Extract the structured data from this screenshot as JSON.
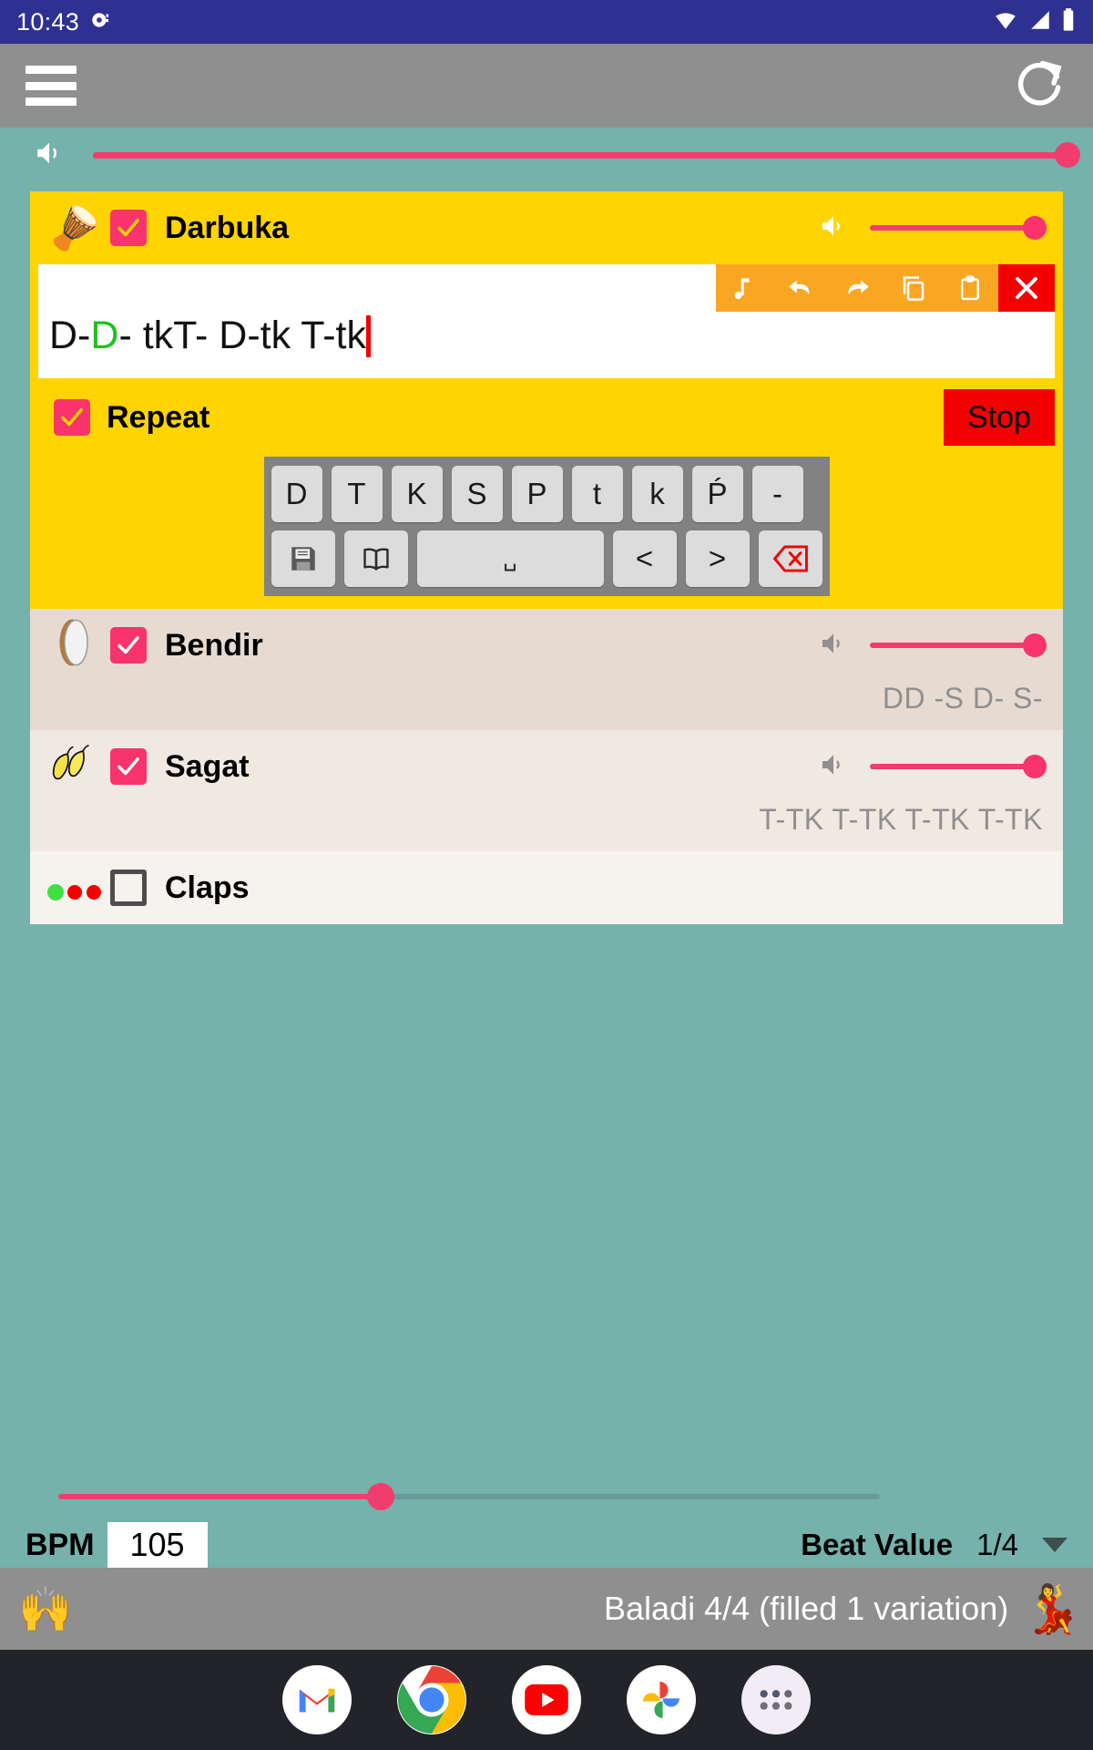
{
  "status_bar": {
    "time": "10:43",
    "notification_icon": "camera-notification-icon",
    "wifi_icon": "wifi-icon",
    "signal_icon": "cell-signal-icon",
    "battery_icon": "battery-icon",
    "background_color": "#2f3192"
  },
  "app_bar": {
    "menu_icon": "hamburger-menu-icon",
    "refresh_icon": "refresh-icon",
    "background_color": "#8f8f8f"
  },
  "master_volume": {
    "speaker_icon": "volume-icon",
    "value_percent": 100
  },
  "instruments": [
    {
      "name": "Darbuka",
      "emoji": "🪘",
      "enabled": true,
      "volume_percent": 100,
      "speaker_icon": "volume-icon",
      "expanded": true,
      "background_color": "#ffd400"
    },
    {
      "name": "Bendir",
      "emoji": "🥁",
      "enabled": true,
      "volume_percent": 100,
      "speaker_icon": "volume-icon",
      "pattern": "DD -S D- S-",
      "background_color": "#e7dbd1"
    },
    {
      "name": "Sagat",
      "emoji": "🦄",
      "enabled": true,
      "volume_percent": 100,
      "speaker_icon": "volume-icon",
      "pattern": "T-TK T-TK T-TK T-TK",
      "background_color": "#f0e9e2"
    },
    {
      "name": "Claps",
      "enabled": false,
      "indicator_dots": [
        "#3fe03f",
        "#f50000",
        "#f50000"
      ],
      "background_color": "#f6f2ee"
    }
  ],
  "editor": {
    "text_before": "D-",
    "text_highlight": "D",
    "text_after": "- tkT- D-tk T-tk",
    "full_text": "D-D- tkT- D-tk T-tk",
    "highlight_color": "#20c020",
    "caret_color": "#f30000",
    "toolbar": [
      {
        "icon": "music-note-icon",
        "label": "Note"
      },
      {
        "icon": "undo-icon",
        "label": "Undo"
      },
      {
        "icon": "redo-icon",
        "label": "Redo"
      },
      {
        "icon": "copy-icon",
        "label": "Copy"
      },
      {
        "icon": "paste-icon",
        "label": "Paste"
      },
      {
        "icon": "close-icon",
        "label": "Close"
      }
    ]
  },
  "controls": {
    "repeat_label": "Repeat",
    "repeat_checked": true,
    "stop_label": "Stop",
    "stop_color": "#f30000"
  },
  "keyboard": {
    "row1": [
      "D",
      "T",
      "K",
      "S",
      "P",
      "t",
      "k",
      "Ṕ",
      "-"
    ],
    "row2": [
      {
        "key": "save",
        "icon": "floppy-disk-icon",
        "label": ""
      },
      {
        "key": "library",
        "icon": "book-icon",
        "label": ""
      },
      {
        "key": "space",
        "icon": "space-icon",
        "label": "␣"
      },
      {
        "key": "prev",
        "icon": "arrow-left-icon",
        "label": "<"
      },
      {
        "key": "next",
        "icon": "arrow-right-icon",
        "label": ">"
      },
      {
        "key": "backspace",
        "icon": "backspace-delete-icon",
        "label": ""
      }
    ]
  },
  "bottom": {
    "bpm_label": "BPM",
    "bpm_value": "105",
    "bpm_slider_percent": 33,
    "beat_value_label": "Beat Value",
    "beat_value": "1/4",
    "dropdown_icon": "chevron-down-icon"
  },
  "footer": {
    "left_emoji": "🙌",
    "title": "Baladi 4/4 (filled 1 variation)",
    "right_emoji": "💃"
  },
  "dock": {
    "items": [
      {
        "name": "gmail",
        "label": "Gmail"
      },
      {
        "name": "chrome",
        "label": "Chrome"
      },
      {
        "name": "youtube",
        "label": "YouTube"
      },
      {
        "name": "photos",
        "label": "Google Photos"
      },
      {
        "name": "app-drawer",
        "label": "All apps"
      }
    ]
  }
}
